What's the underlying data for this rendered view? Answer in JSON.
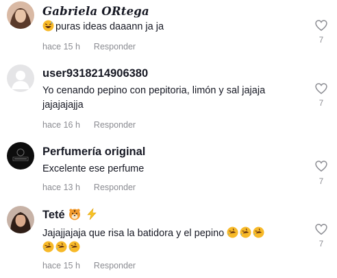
{
  "comments": [
    {
      "username": "Gabriela ORtega",
      "text": "puras ideas daaann ja ja",
      "time": "hace 15 h",
      "reply_label": "Responder",
      "likes": "7",
      "avatar_icon": "user-photo-woman"
    },
    {
      "username": "user9318214906380",
      "text": "Yo cenando pepino con pepitoria, limón y sal jajaja jajajajajja",
      "time": "hace 16 h",
      "reply_label": "Responder",
      "likes": "7",
      "avatar_icon": "default-user"
    },
    {
      "username": "Perfumería original",
      "text": "Excelente ese perfume",
      "time": "hace 13 h",
      "reply_label": "Responder",
      "likes": "7",
      "avatar_icon": "brand-logo-dark"
    },
    {
      "username": "Teté",
      "text": "Jajajjajaja que risa la batidora y el pepino",
      "time": "hace 15 h",
      "reply_label": "Responder",
      "likes": "7",
      "avatar_icon": "user-photo-woman"
    }
  ],
  "colors": {
    "text": "#161823",
    "secondary": "#8a8b91",
    "heart": "#8a8b91"
  }
}
